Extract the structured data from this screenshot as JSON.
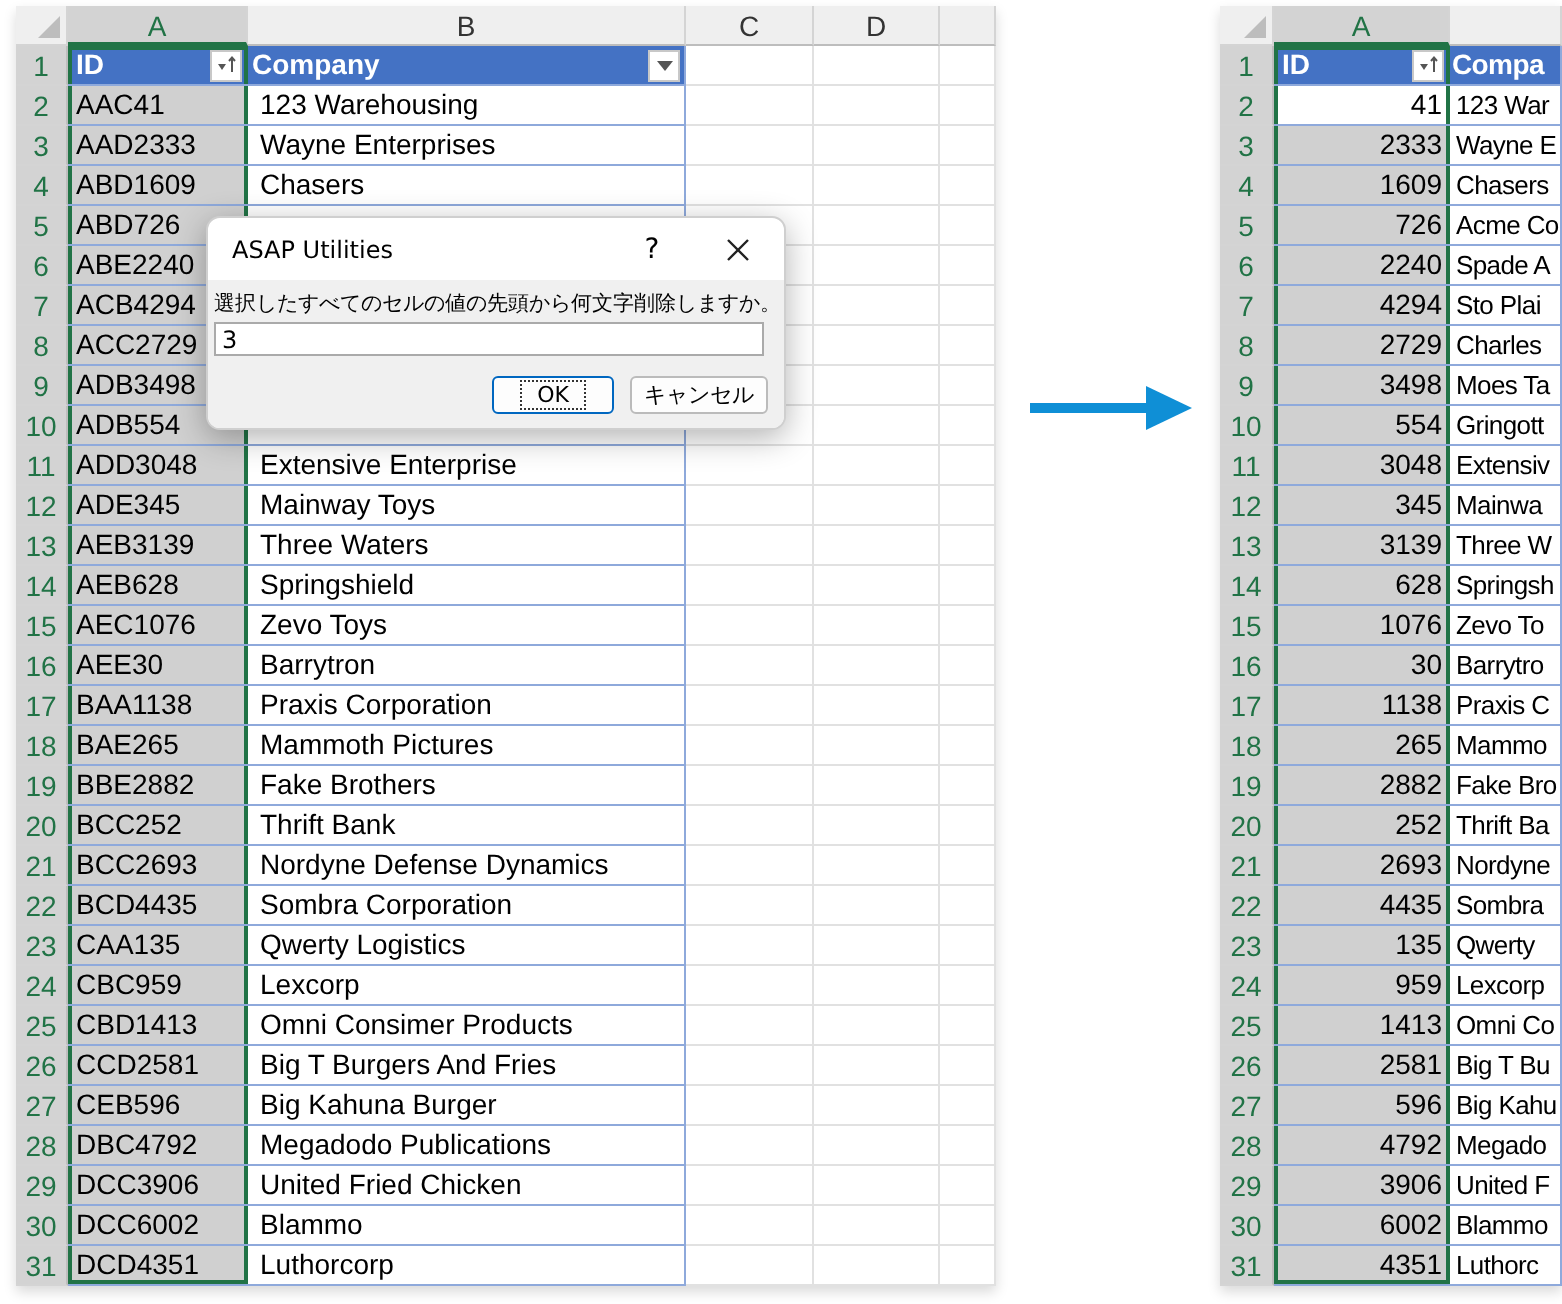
{
  "sheets": [
    {
      "kind": "text",
      "columns": [
        {
          "label": "A",
          "selected": true
        },
        {
          "label": "B",
          "selected": false
        },
        {
          "label": "C",
          "selected": false
        },
        {
          "label": "D",
          "selected": false
        }
      ],
      "header": {
        "row": "1",
        "id": "ID",
        "company": "Company",
        "company_filter": true
      },
      "rows": [
        {
          "row": "2",
          "id": "AAC41",
          "company": "123 Warehousing",
          "active": false
        },
        {
          "row": "3",
          "id": "AAD2333",
          "company": "Wayne Enterprises",
          "active": false
        },
        {
          "row": "4",
          "id": "ABD1609",
          "company": "Chasers",
          "active": false
        },
        {
          "row": "5",
          "id": "ABD726",
          "active": false
        },
        {
          "row": "6",
          "id": "ABE2240",
          "active": false
        },
        {
          "row": "7",
          "id": "ACB4294",
          "active": false
        },
        {
          "row": "8",
          "id": "ACC2729",
          "active": false
        },
        {
          "row": "9",
          "id": "ADB3498",
          "active": false
        },
        {
          "row": "10",
          "id": "ADB554",
          "active": false
        },
        {
          "row": "11",
          "id": "ADD3048",
          "company": "Extensive Enterprise",
          "active": false
        },
        {
          "row": "12",
          "id": "ADE345",
          "company": "Mainway Toys",
          "active": false
        },
        {
          "row": "13",
          "id": "AEB3139",
          "company": "Three Waters",
          "active": false
        },
        {
          "row": "14",
          "id": "AEB628",
          "company": "Springshield",
          "active": false
        },
        {
          "row": "15",
          "id": "AEC1076",
          "company": "Zevo Toys",
          "active": false
        },
        {
          "row": "16",
          "id": "AEE30",
          "company": "Barrytron",
          "active": false
        },
        {
          "row": "17",
          "id": "BAA1138",
          "company": "Praxis Corporation",
          "active": false
        },
        {
          "row": "18",
          "id": "BAE265",
          "company": "Mammoth Pictures",
          "active": false
        },
        {
          "row": "19",
          "id": "BBE2882",
          "company": "Fake Brothers",
          "active": false
        },
        {
          "row": "20",
          "id": "BCC252",
          "company": "Thrift Bank",
          "active": false
        },
        {
          "row": "21",
          "id": "BCC2693",
          "company": "Nordyne Defense Dynamics",
          "active": false
        },
        {
          "row": "22",
          "id": "BCD4435",
          "company": "Sombra Corporation",
          "active": false
        },
        {
          "row": "23",
          "id": "CAA135",
          "company": "Qwerty Logistics",
          "active": false
        },
        {
          "row": "24",
          "id": "CBC959",
          "company": "Lexcorp",
          "active": false
        },
        {
          "row": "25",
          "id": "CBD1413",
          "company": "Omni Consimer Products",
          "active": false
        },
        {
          "row": "26",
          "id": "CCD2581",
          "company": "Big T Burgers And Fries",
          "active": false
        },
        {
          "row": "27",
          "id": "CEB596",
          "company": "Big Kahuna Burger",
          "active": false
        },
        {
          "row": "28",
          "id": "DBC4792",
          "company": "Megadodo Publications",
          "active": false
        },
        {
          "row": "29",
          "id": "DCC3906",
          "company": "United Fried Chicken",
          "active": false
        },
        {
          "row": "30",
          "id": "DCC6002",
          "company": "Blammo",
          "active": false
        },
        {
          "row": "31",
          "id": "DCD4351",
          "company": "Luthorcorp",
          "active": false
        }
      ]
    },
    {
      "kind": "number",
      "columns": [
        {
          "label": "A",
          "selected": true
        }
      ],
      "header": {
        "row": "1",
        "id": "ID",
        "company": "Compa",
        "company_filter": false
      },
      "rows": [
        {
          "row": "2",
          "id": "41",
          "company": "123 War",
          "active": true
        },
        {
          "row": "3",
          "id": "2333",
          "company": "Wayne E",
          "active": false
        },
        {
          "row": "4",
          "id": "1609",
          "company": "Chasers",
          "active": false
        },
        {
          "row": "5",
          "id": "726",
          "company": "Acme Co",
          "active": false
        },
        {
          "row": "6",
          "id": "2240",
          "company": "Spade A",
          "active": false
        },
        {
          "row": "7",
          "id": "4294",
          "company": "Sto Plai",
          "active": false
        },
        {
          "row": "8",
          "id": "2729",
          "company": "Charles",
          "active": false
        },
        {
          "row": "9",
          "id": "3498",
          "company": "Moes Ta",
          "active": false
        },
        {
          "row": "10",
          "id": "554",
          "company": "Gringott",
          "active": false
        },
        {
          "row": "11",
          "id": "3048",
          "company": "Extensiv",
          "active": false
        },
        {
          "row": "12",
          "id": "345",
          "company": "Mainwa",
          "active": false
        },
        {
          "row": "13",
          "id": "3139",
          "company": "Three W",
          "active": false
        },
        {
          "row": "14",
          "id": "628",
          "company": "Springsh",
          "active": false
        },
        {
          "row": "15",
          "id": "1076",
          "company": "Zevo To",
          "active": false
        },
        {
          "row": "16",
          "id": "30",
          "company": "Barrytro",
          "active": false
        },
        {
          "row": "17",
          "id": "1138",
          "company": "Praxis C",
          "active": false
        },
        {
          "row": "18",
          "id": "265",
          "company": "Mammo",
          "active": false
        },
        {
          "row": "19",
          "id": "2882",
          "company": "Fake Bro",
          "active": false
        },
        {
          "row": "20",
          "id": "252",
          "company": "Thrift Ba",
          "active": false
        },
        {
          "row": "21",
          "id": "2693",
          "company": "Nordyne",
          "active": false
        },
        {
          "row": "22",
          "id": "4435",
          "company": "Sombra",
          "active": false
        },
        {
          "row": "23",
          "id": "135",
          "company": "Qwerty",
          "active": false
        },
        {
          "row": "24",
          "id": "959",
          "company": "Lexcorp",
          "active": false
        },
        {
          "row": "25",
          "id": "1413",
          "company": "Omni Co",
          "active": false
        },
        {
          "row": "26",
          "id": "2581",
          "company": "Big T Bu",
          "active": false
        },
        {
          "row": "27",
          "id": "596",
          "company": "Big Kahu",
          "active": false
        },
        {
          "row": "28",
          "id": "4792",
          "company": "Megado",
          "active": false
        },
        {
          "row": "29",
          "id": "3906",
          "company": "United F",
          "active": false
        },
        {
          "row": "30",
          "id": "6002",
          "company": "Blammo",
          "active": false
        },
        {
          "row": "31",
          "id": "4351",
          "company": "Luthorc",
          "active": false
        }
      ]
    }
  ],
  "dialog": {
    "title": "ASAP Utilities",
    "help": "?",
    "prompt": "選択したすべてのセルの値の先頭から何文字削除しますか。",
    "value": "3",
    "buttons": [
      {
        "label": "OK",
        "focused": true
      },
      {
        "label": "キャンセル",
        "focused": false
      }
    ]
  }
}
